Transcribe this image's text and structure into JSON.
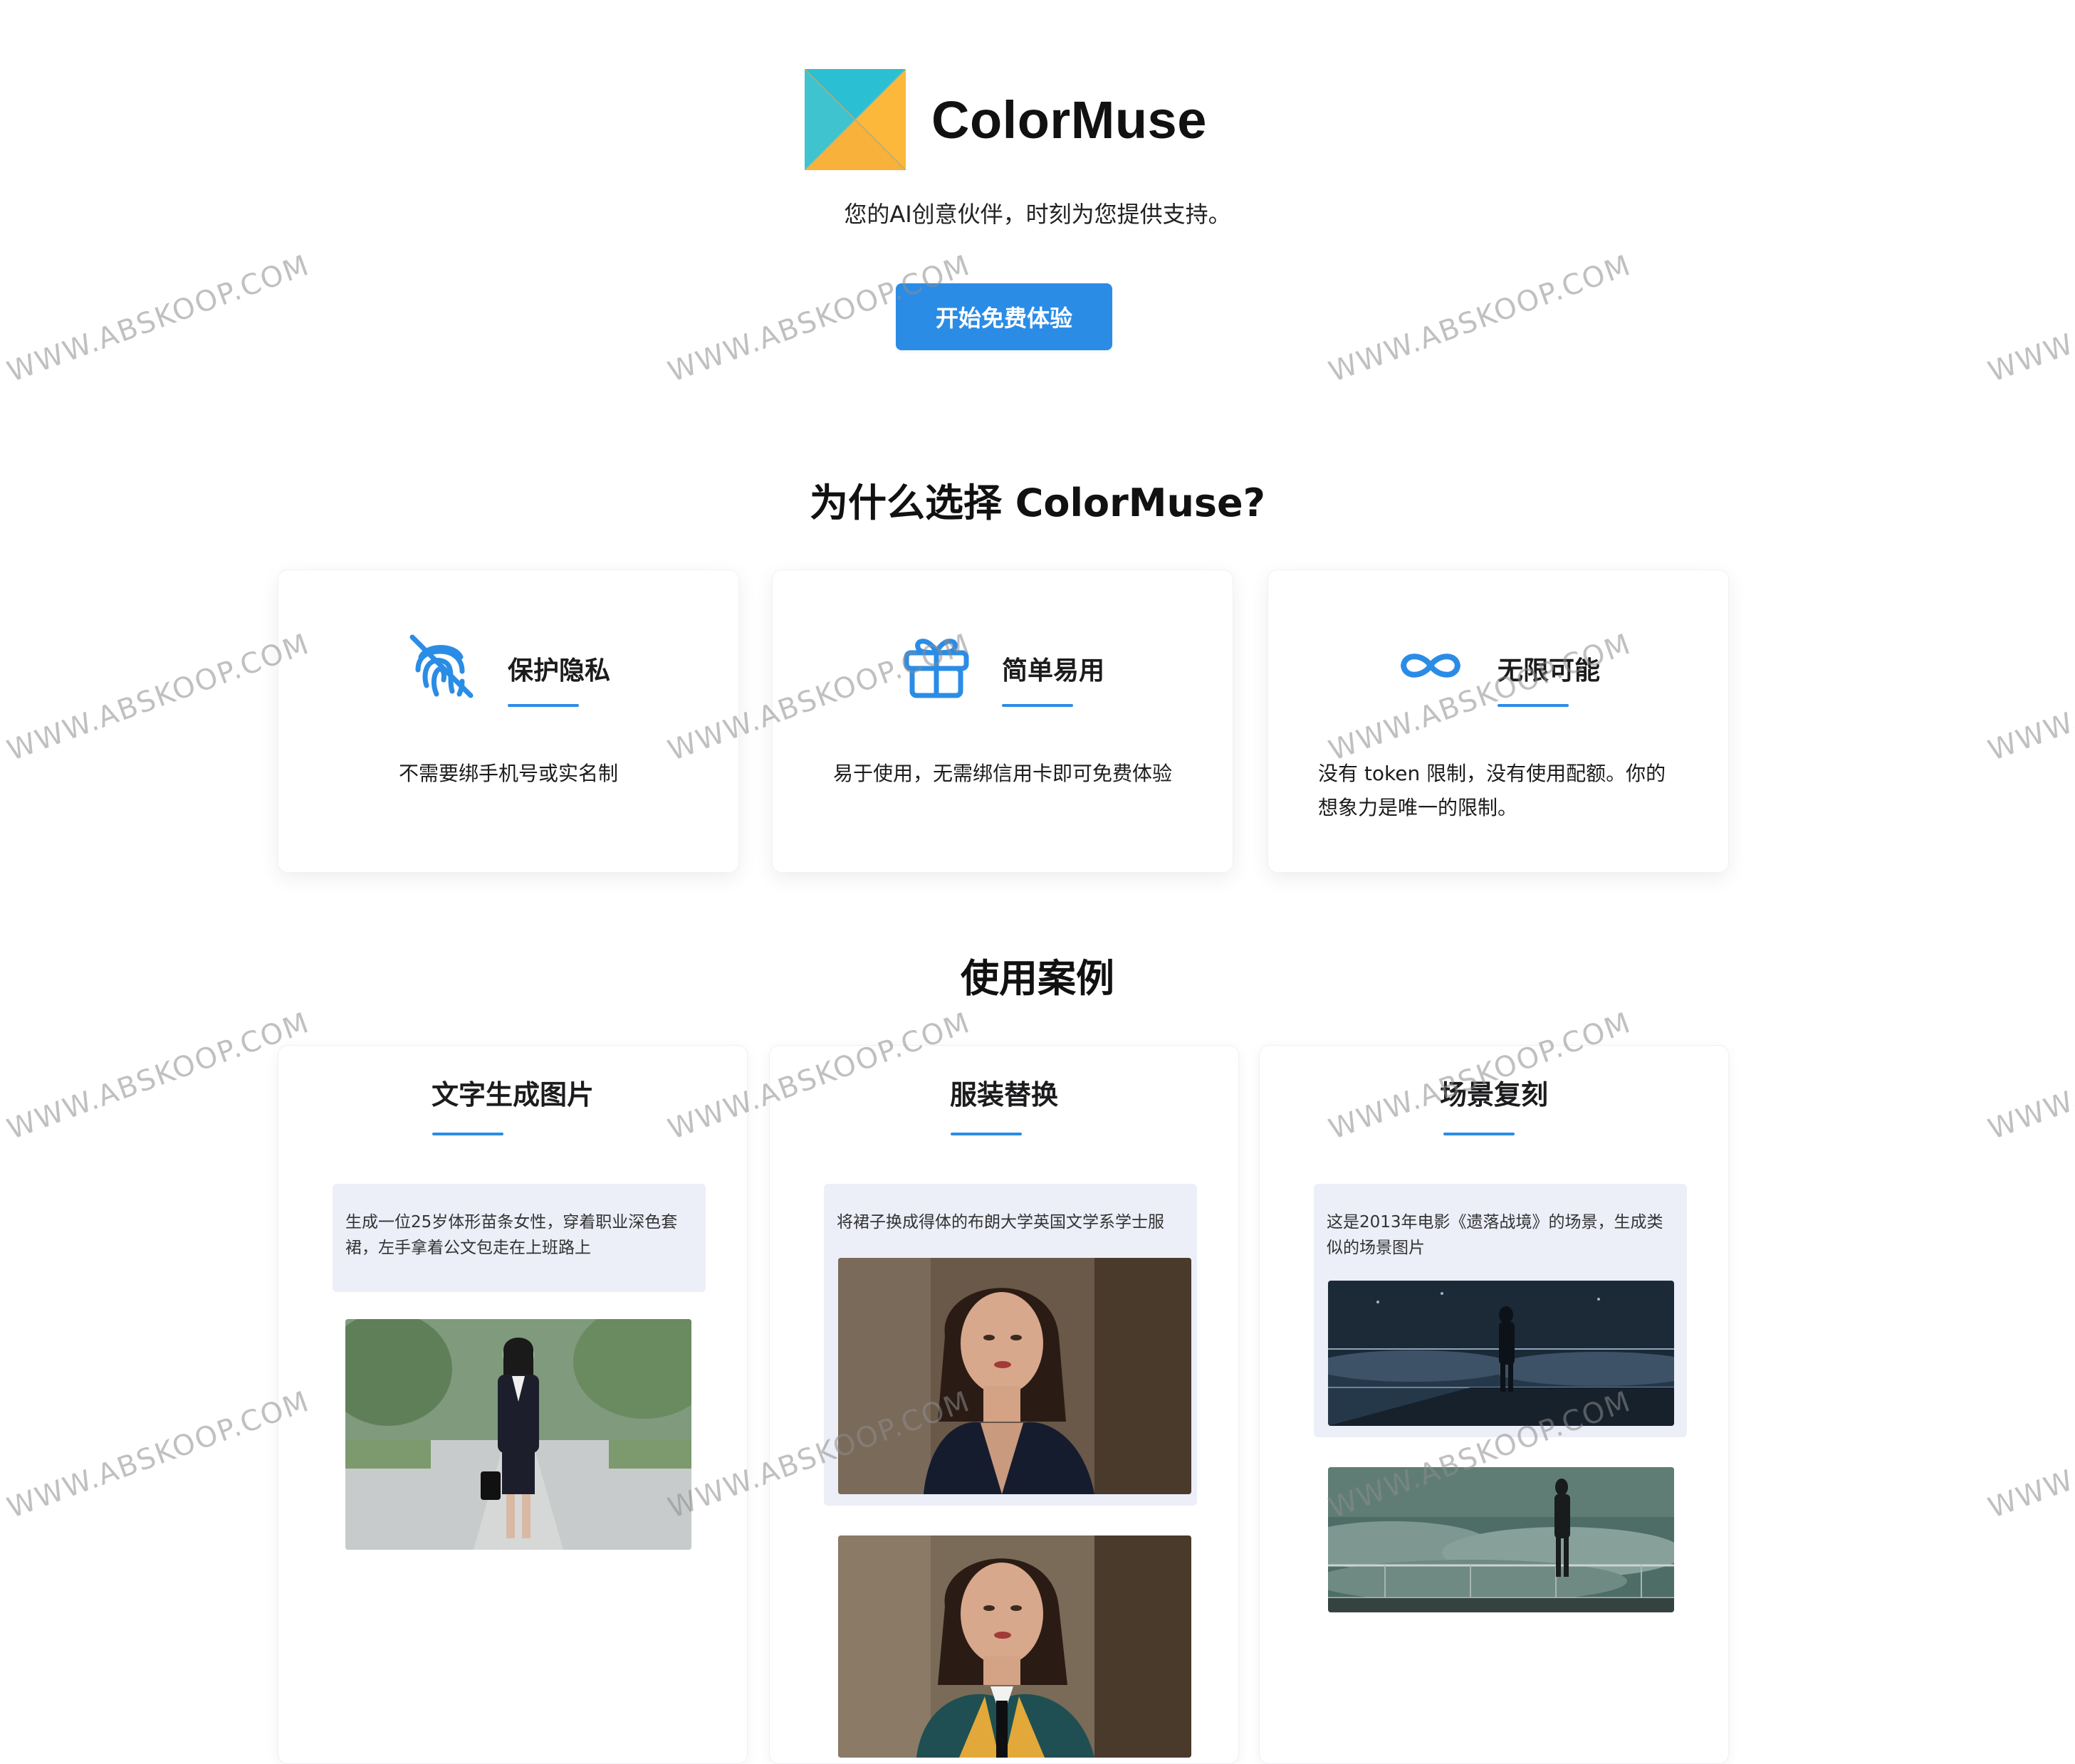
{
  "brand": {
    "name": "ColorMuse",
    "tagline": "您的AI创意伙伴，时刻为您提供支持。",
    "cta_label": "开始免费体验",
    "logo_colors": [
      "#2bbfd4",
      "#fbb83a"
    ],
    "accent": "#2b8ce6"
  },
  "features": {
    "title": "为什么选择 ColorMuse?",
    "items": [
      {
        "icon": "fingerprint-icon",
        "label": "保护隐私",
        "desc": "不需要绑手机号或实名制"
      },
      {
        "icon": "gift-icon",
        "label": "简单易用",
        "desc": "易于使用，无需绑信用卡即可免费体验"
      },
      {
        "icon": "infinity-icon",
        "label": "无限可能",
        "desc": "没有 token 限制，没有使用配额。你的想象力是唯一的限制。"
      }
    ]
  },
  "cases": {
    "title": "使用案例",
    "items": [
      {
        "title": "文字生成图片",
        "prompt": "生成一位25岁体形苗条女性，穿着职业深色套裙，左手拿着公文包走在上班路上"
      },
      {
        "title": "服装替换",
        "prompt": "将裙子换成得体的布朗大学英国文学系学士服"
      },
      {
        "title": "场景复刻",
        "prompt": "这是2013年电影《遗落战境》的场景，生成类似的场景图片"
      }
    ]
  },
  "watermark": "WWW.ABSKOOP.COM"
}
